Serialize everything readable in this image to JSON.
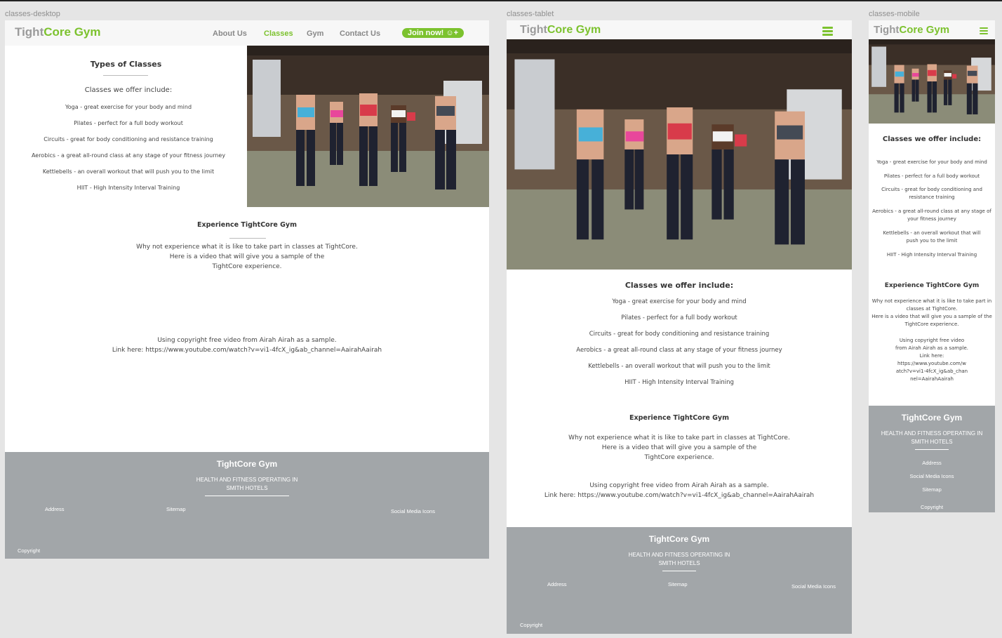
{
  "frames": {
    "desktop": "classes-desktop",
    "tablet": "classes-tablet",
    "mobile": "classes-mobile"
  },
  "brand": {
    "part1": "Tight",
    "part2": "Core Gym",
    "accent": "#7cc22e",
    "grey": "#9b9b9b"
  },
  "nav": {
    "items": [
      "About Us",
      "Classes",
      "Gym",
      "Contact Us"
    ],
    "join": "Join now!",
    "join_icon": "user-plus-icon",
    "menu_icon": "hamburger-menu-icon"
  },
  "classes": {
    "heading": "Types of Classes",
    "intro": "Classes we offer include:",
    "list": [
      "Yoga - great exercise for your body and mind",
      "Pilates - perfect for a full body workout",
      "Circuits - great for body conditioning and resistance training",
      "Aerobics - a great all-round class at any stage of your fitness journey",
      "Kettlebells - an overall workout that will push you to the limit",
      "HIIT - High Intensity Interval Training"
    ],
    "mobile_list": [
      [
        "Yoga - great exercise for your body and mind"
      ],
      [
        "Pilates - perfect for a full body workout"
      ],
      [
        "Circuits - great for body conditioning and",
        "resistance training"
      ],
      [
        "Aerobics - a great all-round class at any stage of",
        "your fitness journey"
      ],
      [
        "Kettlebells - an overall workout that will",
        "push you to the limit"
      ],
      [
        "HIIT - High Intensity Interval Training"
      ]
    ]
  },
  "experience": {
    "heading": "Experience TightCore Gym",
    "lines": [
      "Why not experience what it is like to take part in classes at TightCore.",
      "Here is a video that will give you a sample of the",
      "TightCore experience."
    ],
    "mobile_lines": [
      "Why not experience what it is like to take part in",
      "classes at TightCore.",
      "Here is a video that will give you a sample of the",
      "TightCore experience."
    ],
    "video_lines": [
      "Using copyright free video from Airah Airah as a sample.",
      "Link here: https://www.youtube.com/watch?v=vi1-4fcX_ig&ab_channel=AairahAairah"
    ],
    "video_mobile_lines": [
      "Using copyright free video",
      "from Airah Airah as a sample.",
      "Link here:",
      "https://www.youtube.com/w",
      "atch?v=vi1-4fcX_ig&ab_chan",
      "nel=AairahAairah"
    ]
  },
  "footer": {
    "title": "TightCore Gym",
    "sub_lines": [
      "HEALTH AND FITNESS OPERATING IN",
      "SMITH HOTELS"
    ],
    "address": "Address",
    "sitemap": "Sitemap",
    "social": "Social Media Icons",
    "copyright": "Copyright",
    "bg": "#a2a6a9"
  }
}
